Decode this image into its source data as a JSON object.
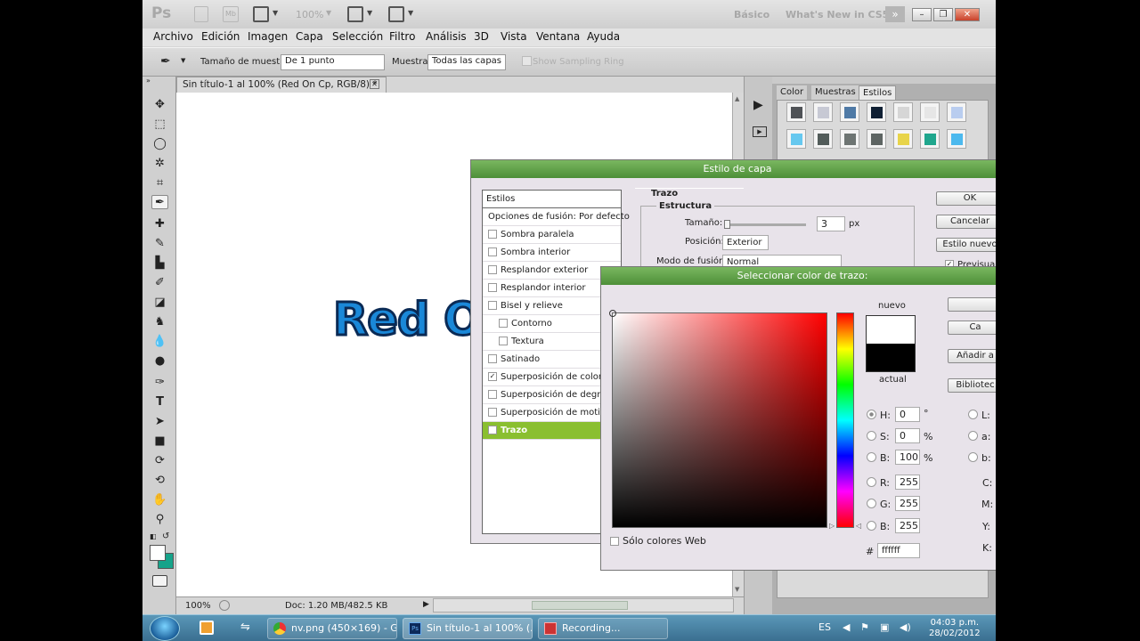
{
  "appbar": {
    "logo": "Ps",
    "zoom": "100%",
    "workspace_basic": "Básico",
    "workspace_new": "What's New in CS5"
  },
  "menu": [
    "Archivo",
    "Edición",
    "Imagen",
    "Capa",
    "Selección",
    "Filtro",
    "Análisis",
    "3D",
    "Vista",
    "Ventana",
    "Ayuda"
  ],
  "options": {
    "sample_size_label": "Tamaño de muestra:",
    "sample_size_value": "De 1 punto",
    "sample_label": "Muestra:",
    "sample_value": "Todas las capas",
    "sampling_ring": "Show Sampling Ring"
  },
  "document": {
    "tab_title": "Sin título-1 al 100% (Red On Cp, RGB/8) *",
    "canvas_text": "Red O",
    "status_zoom": "100%",
    "status_doc": "Doc: 1.20 MB/482.5 KB"
  },
  "panels": {
    "tabs": [
      "Color",
      "Muestras",
      "Estilos"
    ],
    "active_tab": "Estilos",
    "styles_row1": [
      "#4f5256",
      "#c7c9d4",
      "#4f7aa6",
      "#0f1f33",
      "#d6d6d6",
      "#e6e6e6",
      "#b9cdef"
    ],
    "styles_row2": [
      "#66c8ef",
      "#525c5a",
      "#6e7573",
      "#5e6563",
      "#e8d44a",
      "#1fa68d",
      "#4cb9ee"
    ]
  },
  "layer_style": {
    "title": "Estilo de capa",
    "list_header": "Estilos",
    "items": [
      {
        "label": "Opciones de fusión: Por defecto",
        "checkbox": false,
        "checked": false,
        "indent": false,
        "selected": false
      },
      {
        "label": "Sombra paralela",
        "checkbox": true,
        "checked": false,
        "indent": false,
        "selected": false
      },
      {
        "label": "Sombra interior",
        "checkbox": true,
        "checked": false,
        "indent": false,
        "selected": false
      },
      {
        "label": "Resplandor exterior",
        "checkbox": true,
        "checked": false,
        "indent": false,
        "selected": false
      },
      {
        "label": "Resplandor interior",
        "checkbox": true,
        "checked": false,
        "indent": false,
        "selected": false
      },
      {
        "label": "Bisel y relieve",
        "checkbox": true,
        "checked": false,
        "indent": false,
        "selected": false
      },
      {
        "label": "Contorno",
        "checkbox": true,
        "checked": false,
        "indent": true,
        "selected": false
      },
      {
        "label": "Textura",
        "checkbox": true,
        "checked": false,
        "indent": true,
        "selected": false
      },
      {
        "label": "Satinado",
        "checkbox": true,
        "checked": false,
        "indent": false,
        "selected": false
      },
      {
        "label": "Superposición de colores",
        "checkbox": true,
        "checked": true,
        "indent": false,
        "selected": false
      },
      {
        "label": "Superposición de degradado",
        "checkbox": true,
        "checked": false,
        "indent": false,
        "selected": false
      },
      {
        "label": "Superposición de motivo",
        "checkbox": true,
        "checked": false,
        "indent": false,
        "selected": false
      },
      {
        "label": "Trazo",
        "checkbox": true,
        "checked": true,
        "indent": false,
        "selected": true
      }
    ],
    "section_title": "Trazo",
    "group_title": "Estructura",
    "size_label": "Tamaño:",
    "size_value": "3",
    "size_unit": "px",
    "position_label": "Posición:",
    "position_value": "Exterior",
    "blend_label": "Modo de fusión:",
    "blend_value": "Normal",
    "ok": "OK",
    "cancel": "Cancelar",
    "new_style": "Estilo nuevo",
    "preview": "Previsuali"
  },
  "color_picker": {
    "title": "Seleccionar color de trazo:",
    "new_label": "nuevo",
    "current_label": "actual",
    "new_color": "#ffffff",
    "current_color": "#000000",
    "btn_cancel": "Ca",
    "btn_add": "Añadir a",
    "btn_libraries": "Bibliotec",
    "web_only": "Sólo colores Web",
    "H": {
      "label": "H:",
      "value": "0",
      "unit": "°"
    },
    "S": {
      "label": "S:",
      "value": "0",
      "unit": "%"
    },
    "Bv": {
      "label": "B:",
      "value": "100",
      "unit": "%"
    },
    "R": {
      "label": "R:",
      "value": "255"
    },
    "G": {
      "label": "G:",
      "value": "255"
    },
    "B": {
      "label": "B:",
      "value": "255"
    },
    "hash": "#",
    "hex": "ffffff",
    "lab": [
      "L:",
      "a:",
      "b:"
    ],
    "cmyk": [
      "C:",
      "M:",
      "Y:",
      "K:"
    ]
  },
  "taskbar": {
    "items": [
      "nv.png (450×169) - G...",
      "Sin título-1 al 100% (...",
      "Recording..."
    ],
    "lang": "ES",
    "time": "04:03 p.m.",
    "date": "28/02/2012"
  }
}
